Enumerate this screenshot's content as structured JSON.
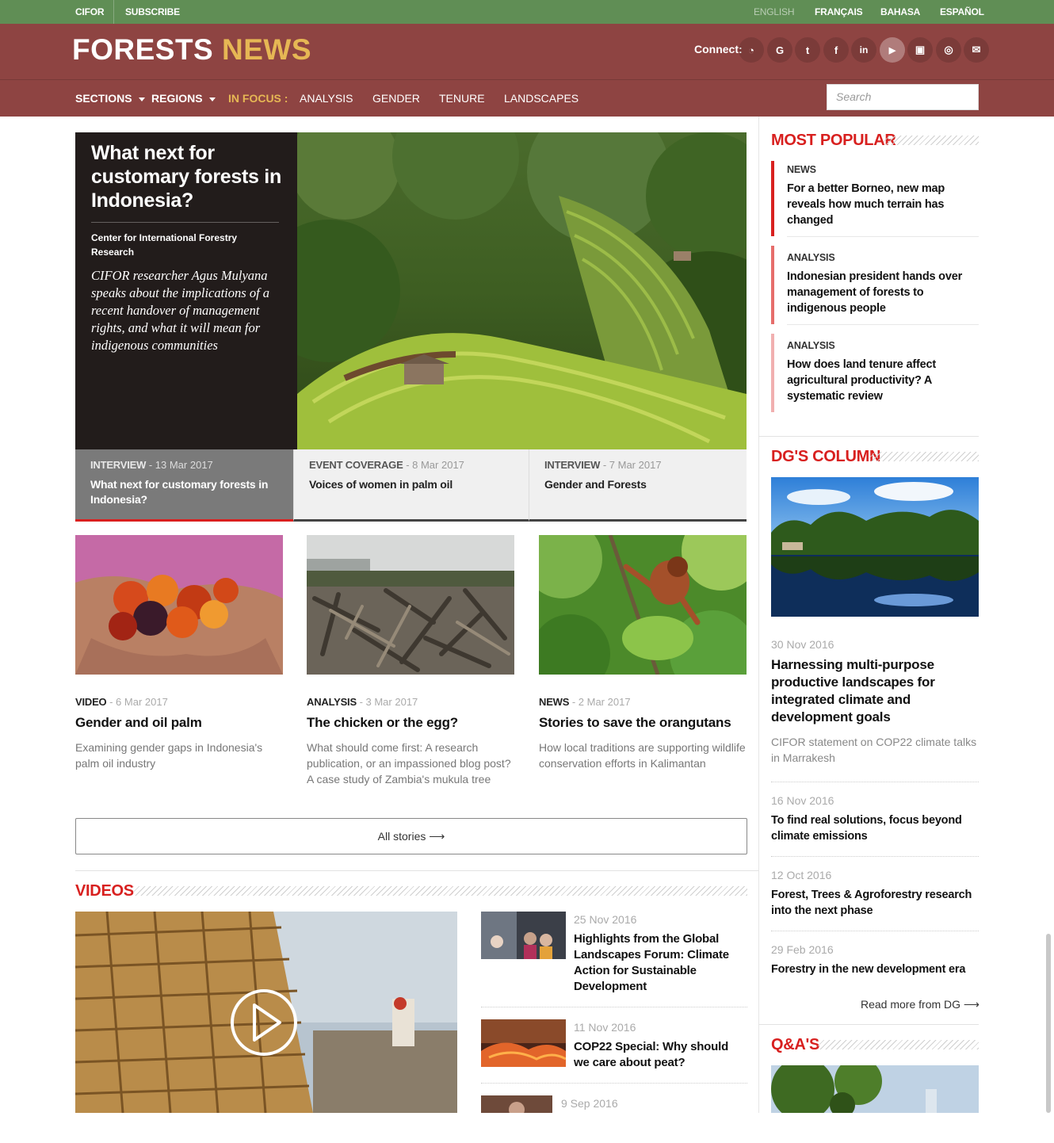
{
  "topbar": {
    "cifor": "CIFOR",
    "subscribe": "SUBSCRIBE",
    "languages": [
      "ENGLISH",
      "FRANÇAIS",
      "BAHASA",
      "ESPAÑOL"
    ],
    "active_language": "ENGLISH"
  },
  "header": {
    "logo_part1": "FORESTS",
    "logo_part2": "NEWS",
    "connect_label": "Connect:",
    "social_icons": [
      "rss-icon",
      "google-icon",
      "twitter-icon",
      "facebook-icon",
      "linkedin-icon",
      "youtube-icon",
      "slideshare-icon",
      "instagram-icon",
      "email-icon"
    ],
    "social_glyphs": [
      "◔",
      "G",
      "t",
      "f",
      "in",
      "▶",
      "▣",
      "◎",
      "✉"
    ]
  },
  "nav": {
    "sections": "SECTIONS",
    "regions": "REGIONS",
    "in_focus": "IN FOCUS :",
    "focus_items": [
      "ANALYSIS",
      "GENDER",
      "TENURE",
      "LANDSCAPES"
    ],
    "search_placeholder": "Search"
  },
  "hero": {
    "title": "What next for customary forests in Indonesia?",
    "org": "Center for International Forestry Research",
    "description": "CIFOR researcher Agus Mulyana speaks about the implications of a recent handover of management rights, and what it will mean for indigenous communities"
  },
  "tabs": [
    {
      "category": "INTERVIEW",
      "date": "13 Mar 2017",
      "title": "What next for customary forests in Indonesia?"
    },
    {
      "category": "EVENT COVERAGE",
      "date": "8 Mar 2017",
      "title": "Voices of women in palm oil"
    },
    {
      "category": "INTERVIEW",
      "date": "7 Mar 2017",
      "title": "Gender and Forests"
    }
  ],
  "cards": [
    {
      "category": "VIDEO",
      "date": "6 Mar 2017",
      "title": "Gender and oil palm",
      "description": "Examining gender gaps in Indonesia's palm oil industry"
    },
    {
      "category": "ANALYSIS",
      "date": "3 Mar 2017",
      "title": "The chicken or the egg?",
      "description": "What should come first: A research publication, or an impassioned blog post? A case study of Zambia's mukula tree"
    },
    {
      "category": "NEWS",
      "date": "2 Mar 2017",
      "title": "Stories to save the orangutans",
      "description": "How local traditions are supporting wildlife conservation efforts in Kalimantan"
    }
  ],
  "all_stories": "All stories ⟶",
  "videos": {
    "heading": "VIDEOS",
    "items": [
      {
        "date": "25 Nov 2016",
        "title": "Highlights from the Global Landscapes Forum: Climate Action for Sustainable Development"
      },
      {
        "date": "11 Nov 2016",
        "title": "COP22 Special: Why should we care about peat?"
      },
      {
        "date": "9 Sep 2016",
        "title": ""
      }
    ]
  },
  "most_popular": {
    "heading": "MOST POPULAR",
    "items": [
      {
        "category": "NEWS",
        "title": "For a better Borneo, new map reveals how much terrain has changed"
      },
      {
        "category": "ANALYSIS",
        "title": "Indonesian president hands over management of forests to indigenous people"
      },
      {
        "category": "ANALYSIS",
        "title": "How does land tenure affect agricultural productivity? A systematic review"
      }
    ]
  },
  "dg_column": {
    "heading": "DG'S COLUMN",
    "featured": {
      "date": "30 Nov 2016",
      "title": "Harnessing multi-purpose productive landscapes for integrated climate and development goals",
      "subtitle": "CIFOR statement on COP22 climate talks in Marrakesh"
    },
    "items": [
      {
        "date": "16 Nov 2016",
        "title": "To find real solutions, focus beyond climate emissions"
      },
      {
        "date": "12 Oct 2016",
        "title": "Forest, Trees & Agroforestry research into the next phase"
      },
      {
        "date": "29 Feb 2016",
        "title": "Forestry in the new development era"
      }
    ],
    "read_more": "Read more from DG ⟶"
  },
  "qa": {
    "heading": "Q&A'S"
  },
  "colors": {
    "topbar_green": "#608e55",
    "header_maroon": "#8e4442",
    "accent_red": "#d8201f",
    "logo_gold": "#e6b754"
  }
}
